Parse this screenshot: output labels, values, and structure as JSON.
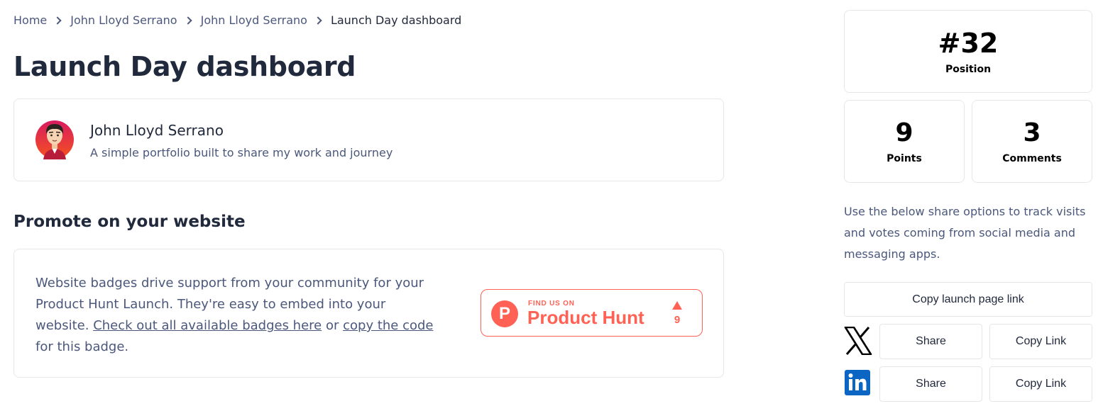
{
  "breadcrumb": [
    {
      "label": "Home"
    },
    {
      "label": "John Lloyd Serrano"
    },
    {
      "label": "John Lloyd Serrano"
    },
    {
      "label": "Launch Day dashboard"
    }
  ],
  "page_title": "Launch Day dashboard",
  "product": {
    "name": "John Lloyd Serrano",
    "tagline": "A simple portfolio built to share my work and journey"
  },
  "promote": {
    "title": "Promote on your website",
    "text_1": "Website badges drive support from your community for your Product Hunt Launch. They're easy to embed into your website. ",
    "link_all_badges": "Check out all available badges here",
    "text_or": " or ",
    "link_copy_code": "copy the code",
    "text_end": " for this badge.",
    "badge": {
      "find_us": "FIND US ON",
      "name": "Product Hunt",
      "logo_letter": "P",
      "votes": "9"
    }
  },
  "stats": {
    "position_value": "#32",
    "position_label": "Position",
    "points_value": "9",
    "points_label": "Points",
    "comments_value": "3",
    "comments_label": "Comments"
  },
  "share": {
    "info": "Use the below share options to track visits and votes coming from social media and messaging apps.",
    "copy_launch_label": "Copy launch page link",
    "x": {
      "share_label": "Share",
      "copy_label": "Copy Link"
    },
    "linkedin": {
      "share_label": "Share",
      "copy_label": "Copy Link"
    }
  },
  "colors": {
    "brand": "#ff6154",
    "text_primary": "#21293c",
    "text_secondary": "#4b587c",
    "border": "#e5e7eb",
    "linkedin": "#0a66c2"
  },
  "icons": [
    "chevron-right-icon",
    "product-hunt-logo-icon",
    "upvote-arrow-icon",
    "x-logo-icon",
    "linkedin-logo-icon"
  ]
}
